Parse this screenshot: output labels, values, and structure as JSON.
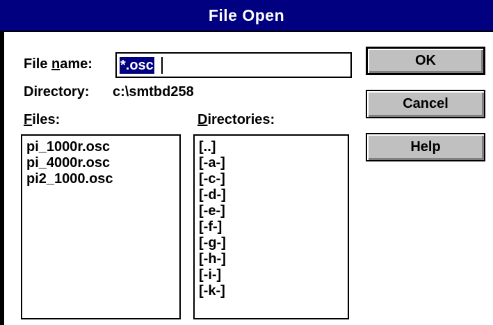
{
  "window": {
    "title": "File Open"
  },
  "file_name": {
    "label_pre": "File ",
    "label_hot": "n",
    "label_post": "ame:",
    "value": "*.osc"
  },
  "directory": {
    "label": "Directory:",
    "path": "c:\\smtbd258"
  },
  "files": {
    "label_hot": "F",
    "label_post": "iles:",
    "items": [
      "pi_1000r.osc",
      "pi_4000r.osc",
      "pi2_1000.osc"
    ]
  },
  "directories": {
    "label_hot": "D",
    "label_post": "irectories:",
    "items": [
      "[..]",
      "[-a-]",
      "[-c-]",
      "[-d-]",
      "[-e-]",
      "[-f-]",
      "[-g-]",
      "[-h-]",
      "[-i-]",
      "[-k-]"
    ]
  },
  "buttons": {
    "ok": "OK",
    "cancel": "Cancel",
    "help": "Help"
  },
  "colors": {
    "title_bar": "#000080",
    "selection": "#000080",
    "button_face": "#c0c0c0"
  }
}
